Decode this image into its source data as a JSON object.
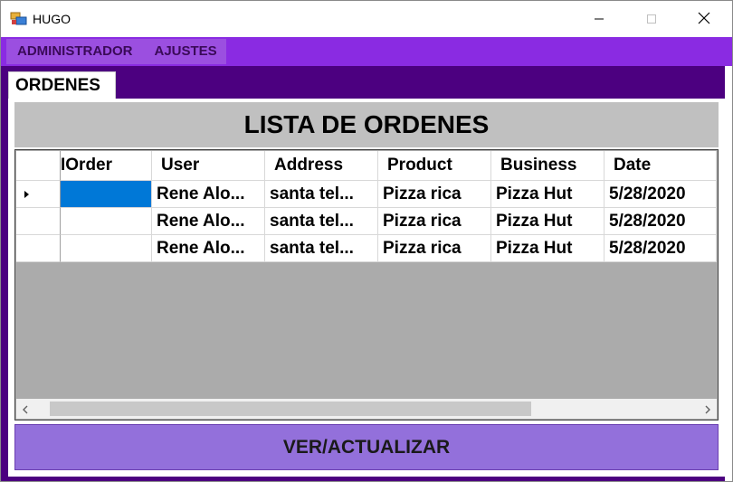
{
  "window": {
    "title": "HUGO",
    "icon": "app-form-icon",
    "controls": [
      "minimize-icon",
      "maximize-icon",
      "close-icon"
    ]
  },
  "menu": {
    "items": [
      {
        "label": "ADMINISTRADOR"
      },
      {
        "label": "AJUSTES"
      }
    ]
  },
  "tabs": [
    {
      "label": "ORDENES",
      "active": true
    }
  ],
  "panel": {
    "header": "LISTA DE ORDENES",
    "button_label": "VER/ACTUALIZAR"
  },
  "grid": {
    "columns": [
      "IOrder",
      "User",
      "Address",
      "Product",
      "Business",
      "Date"
    ],
    "rows": [
      {
        "order": "",
        "user": "Rene Alo...",
        "address": "santa tel...",
        "product": "Pizza rica",
        "business": "Pizza Hut",
        "date": "5/28/2020",
        "current": true
      },
      {
        "order": "",
        "user": "Rene Alo...",
        "address": "santa tel...",
        "product": "Pizza rica",
        "business": "Pizza Hut",
        "date": "5/28/2020",
        "current": false
      },
      {
        "order": "",
        "user": "Rene Alo...",
        "address": "santa tel...",
        "product": "Pizza rica",
        "business": "Pizza Hut",
        "date": "5/28/2020",
        "current": false
      }
    ],
    "scroll_left": "<",
    "scroll_right": ">"
  },
  "colors": {
    "menubar": "#8a2be2",
    "content_bg": "#4c0080",
    "button": "#9370db",
    "selection": "#0078d7"
  }
}
